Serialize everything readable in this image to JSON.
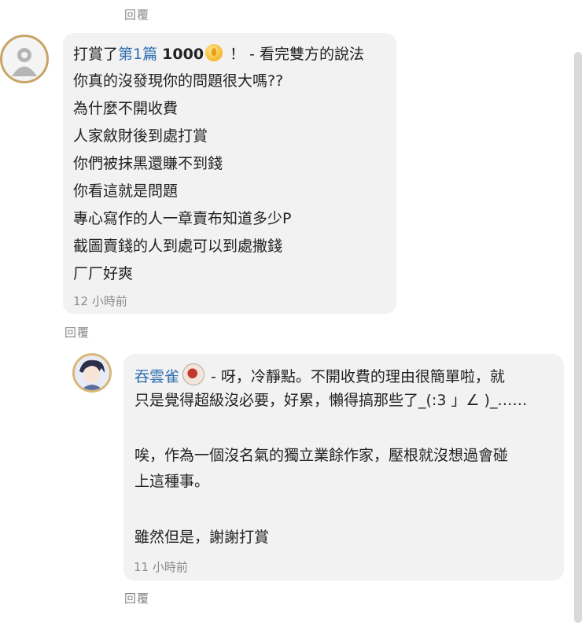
{
  "top_reply": "回覆",
  "comment": {
    "prefix": "打賞了",
    "chapter_link": "第1篇",
    "amount": "1000",
    "suffix": "！ - 看完雙方的說法",
    "lines": [
      "你真的沒發現你的問題很大嗎??",
      "為什麼不開收費",
      "人家斂財後到處打賞",
      "你們被抹黑還賺不到錢",
      "你看這就是問題",
      "專心寫作的人一章賣布知道多少P",
      "截圖賣錢的人到處可以到處撒錢",
      "厂厂好爽"
    ],
    "time": "12 小時前",
    "reply": "回覆"
  },
  "author_reply": {
    "author_name": "吞雲雀",
    "first_line": "- 呀，冷靜點。不開收費的理由很簡單啦，就",
    "lines": [
      "只是覺得超級沒必要，好累，懶得搞那些了_(:3 」∠ )_……",
      "",
      "唉，作為一個沒名氣的獨立業餘作家，壓根就沒想過會碰",
      "上這種事。",
      "",
      "雖然但是，謝謝打賞"
    ],
    "time": "11 小時前",
    "reply": "回覆"
  },
  "colors": {
    "link_blue": "#2f6fb1",
    "bubble_bg": "#f2f2f2",
    "meta_gray": "#8a8a8a",
    "avatar_border": "#c9a467"
  },
  "icons": [
    "default-avatar-icon",
    "coin-icon",
    "author-avatar-icon",
    "author-badge-icon"
  ]
}
